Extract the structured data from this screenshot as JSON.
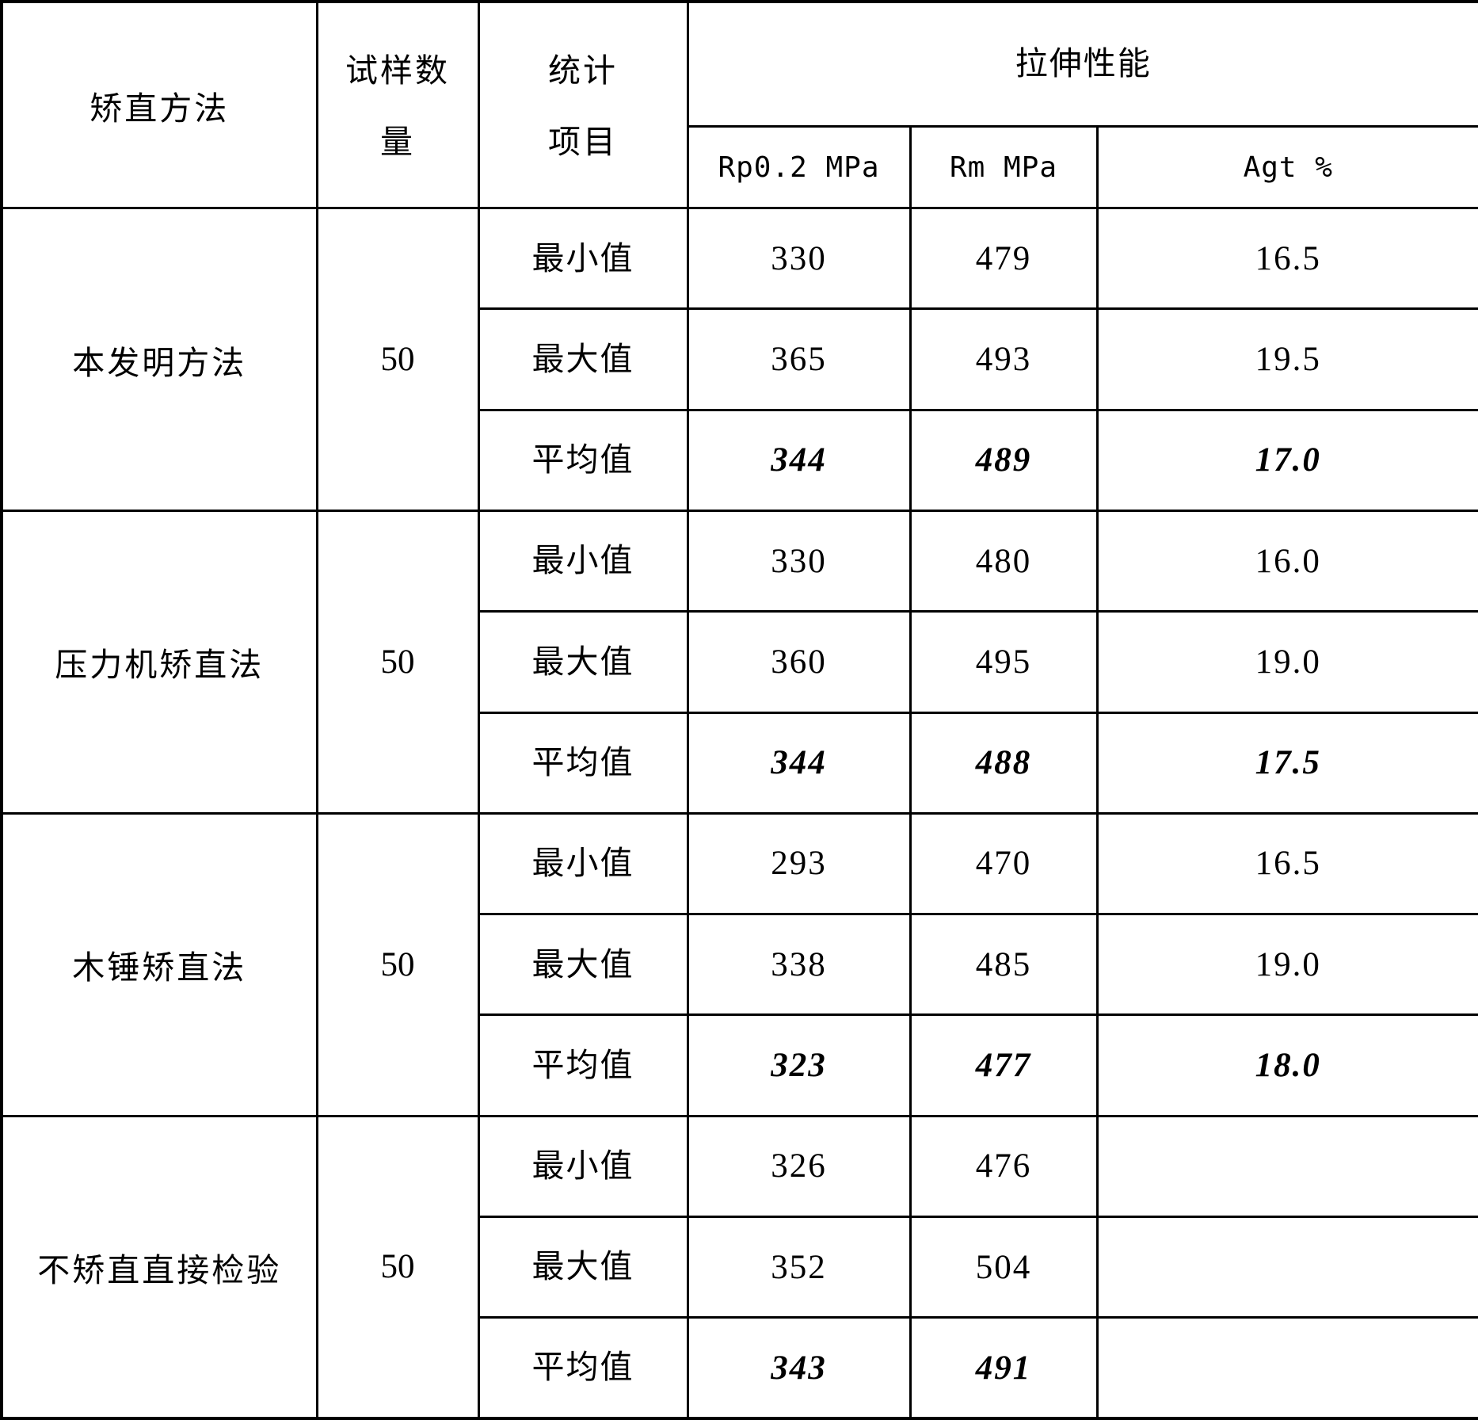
{
  "table": {
    "headers": {
      "method": "矫直方法",
      "sample_count_line1": "试样数",
      "sample_count_line2": "量",
      "stat_item_line1": "统计",
      "stat_item_line2": "项目",
      "tensile_group": "拉伸性能",
      "rp02": "Rp0.2 MPa",
      "rm": "Rm MPa",
      "agt": "Agt %"
    },
    "stat_labels": {
      "min": "最小值",
      "max": "最大值",
      "avg": "平均值"
    },
    "groups": [
      {
        "method": "本发明方法",
        "count": "50",
        "rows": [
          {
            "stat": "最小值",
            "rp02": "330",
            "rm": "479",
            "agt": "16.5",
            "emphasis": false
          },
          {
            "stat": "最大值",
            "rp02": "365",
            "rm": "493",
            "agt": "19.5",
            "emphasis": false
          },
          {
            "stat": "平均值",
            "rp02": "344",
            "rm": "489",
            "agt": "17.0",
            "emphasis": true
          }
        ]
      },
      {
        "method": "压力机矫直法",
        "count": "50",
        "rows": [
          {
            "stat": "最小值",
            "rp02": "330",
            "rm": "480",
            "agt": "16.0",
            "emphasis": false
          },
          {
            "stat": "最大值",
            "rp02": "360",
            "rm": "495",
            "agt": "19.0",
            "emphasis": false
          },
          {
            "stat": "平均值",
            "rp02": "344",
            "rm": "488",
            "agt": "17.5",
            "emphasis": true
          }
        ]
      },
      {
        "method": "木锤矫直法",
        "count": "50",
        "rows": [
          {
            "stat": "最小值",
            "rp02": "293",
            "rm": "470",
            "agt": "16.5",
            "emphasis": false
          },
          {
            "stat": "最大值",
            "rp02": "338",
            "rm": "485",
            "agt": "19.0",
            "emphasis": false
          },
          {
            "stat": "平均值",
            "rp02": "323",
            "rm": "477",
            "agt": "18.0",
            "emphasis": true
          }
        ]
      },
      {
        "method": "不矫直直接检验",
        "count": "50",
        "rows": [
          {
            "stat": "最小值",
            "rp02": "326",
            "rm": "476",
            "agt": "",
            "emphasis": false
          },
          {
            "stat": "最大值",
            "rp02": "352",
            "rm": "504",
            "agt": "",
            "emphasis": false
          },
          {
            "stat": "平均值",
            "rp02": "343",
            "rm": "491",
            "agt": "",
            "emphasis": true
          }
        ]
      }
    ]
  }
}
